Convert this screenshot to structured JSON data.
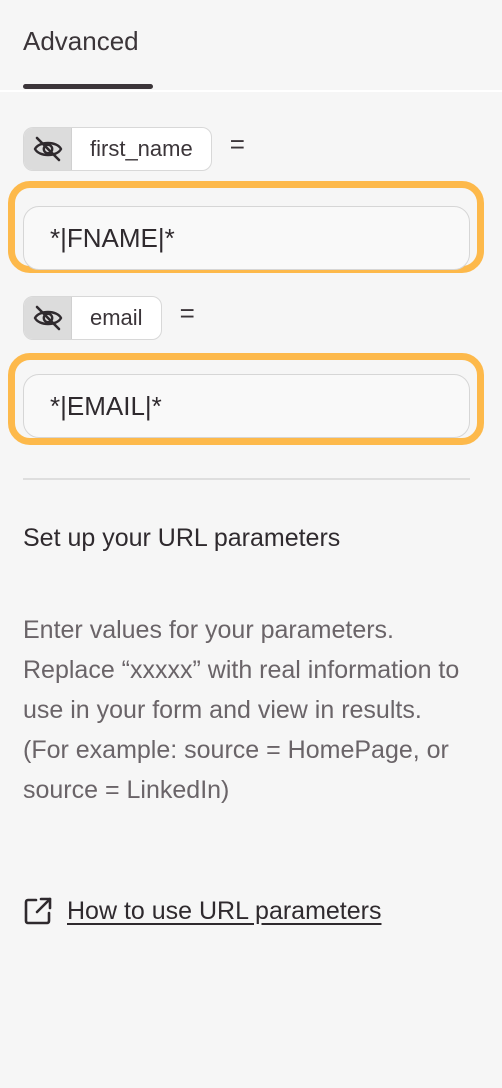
{
  "tabs": {
    "active_label": "Advanced"
  },
  "params": [
    {
      "name": "first_name",
      "equals": "=",
      "value": "*|FNAME|*",
      "visibility_icon": "eye-off-icon"
    },
    {
      "name": "email",
      "equals": "=",
      "value": "*|EMAIL|*",
      "visibility_icon": "eye-off-icon"
    }
  ],
  "colors": {
    "highlight": "#fdb94b",
    "background": "#f6f6f6"
  },
  "help": {
    "title": "Set up your URL parameters",
    "description": "Enter values for your parameters. Replace “xxxxx” with real information to use in your form and view in results. (For example: source = HomePage, or source = LinkedIn)",
    "link_label": "How to use URL parameters",
    "link_icon": "external-link-icon"
  }
}
